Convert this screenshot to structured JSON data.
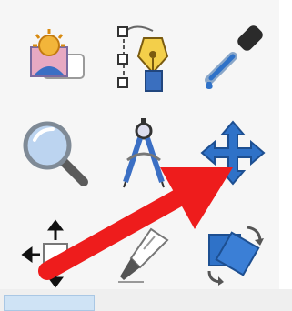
{
  "toolbox": {
    "tools": [
      {
        "icon": "script-fu-icon"
      },
      {
        "icon": "paths-tool-icon"
      },
      {
        "icon": "color-picker-icon"
      },
      {
        "icon": "zoom-tool-icon"
      },
      {
        "icon": "measure-tool-icon"
      },
      {
        "icon": "move-tool-icon"
      },
      {
        "icon": "alignment-tool-icon"
      },
      {
        "icon": "crop-tool-icon"
      },
      {
        "icon": "rotate-tool-icon"
      }
    ]
  },
  "annotation": {
    "color": "#ee1c1c",
    "points_to": "move-tool-icon"
  },
  "colors": {
    "accent_blue": "#2f72c8",
    "selection_blue": "#cfe3f5"
  }
}
